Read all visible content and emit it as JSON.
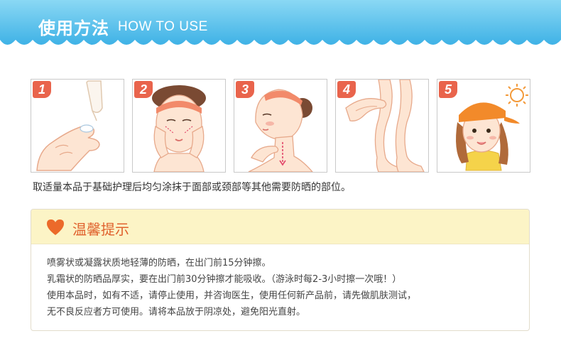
{
  "header": {
    "title": "使用方法",
    "subtitle": "HOW TO USE",
    "colors": {
      "banner_top": "#7fd3f2",
      "banner_bottom": "#4cb8e8"
    }
  },
  "steps": [
    {
      "number": "1",
      "illustration": "hand-applying-lotion"
    },
    {
      "number": "2",
      "illustration": "face-application"
    },
    {
      "number": "3",
      "illustration": "neck-application"
    },
    {
      "number": "4",
      "illustration": "legs-application"
    },
    {
      "number": "5",
      "illustration": "girl-with-cap-in-sun"
    }
  ],
  "caption": "取适量本品于基础护理后均匀涂抹于面部或颈部等其他需要防晒的部位。",
  "tips": {
    "icon": "heart-icon",
    "title": "温馨提示",
    "lines": [
      "喷雾状或凝露状质地轻薄的防晒，在出门前15分钟擦。",
      "乳霜状的防晒品厚实，要在出门前30分钟擦才能吸收。（游泳时每2-3小时擦一次哦！）",
      "使用本品时，如有不适，请停止使用，并咨询医生，使用任何新产品前，请先做肌肤测试，",
      "无不良反应者方可使用。请将本品放于阴凉处，避免阳光直射。"
    ],
    "colors": {
      "accent": "#e0622e",
      "header_bg": "#fcf4c6"
    }
  }
}
